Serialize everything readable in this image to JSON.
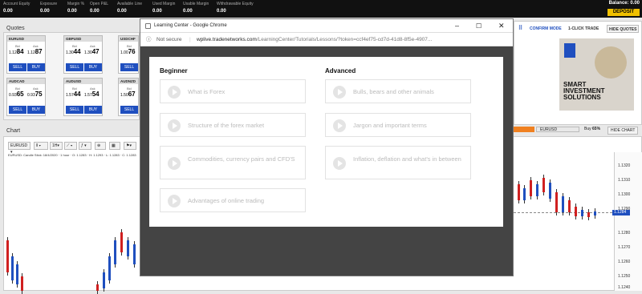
{
  "topbar": {
    "metrics": [
      {
        "label": "Account Equity",
        "value": "0.00"
      },
      {
        "label": "Exposure",
        "value": "0.00"
      },
      {
        "label": "Margin %",
        "value": "0.00"
      },
      {
        "label": "Open P&L",
        "value": "0.00"
      },
      {
        "label": "Available Line",
        "value": "0.00"
      },
      {
        "label": "Used Margin",
        "value": "0.00"
      },
      {
        "label": "Usable Margin",
        "value": "0.00"
      },
      {
        "label": "Withdrawable Equity",
        "value": "0.00"
      }
    ],
    "balance_label": "Balance:",
    "balance_value": "0.00",
    "deposit_label": "DEPOSIT"
  },
  "quotes": {
    "title": "Quotes",
    "cards": [
      {
        "pair": "EURUSD",
        "bid_label": "Bid",
        "ask_label": "Ask",
        "bid_small": "1.12",
        "bid_big": "84",
        "ask_small": "1.12",
        "ask_big": "87",
        "sell": "SELL",
        "buy": "BUY"
      },
      {
        "pair": "GBPUSD",
        "bid_label": "Bid",
        "ask_label": "Ask",
        "bid_small": "1.30",
        "bid_big": "44",
        "ask_small": "1.30",
        "ask_big": "47",
        "sell": "SELL",
        "buy": "BUY"
      },
      {
        "pair": "USDCHF",
        "bid_label": "Bid",
        "ask_label": "",
        "bid_small": "1.00",
        "bid_big": "76",
        "ask_small": "",
        "ask_big": "",
        "sell": "SELL",
        "buy": ""
      },
      {
        "pair": "AUDCAD",
        "bid_label": "Bid",
        "ask_label": "Ask",
        "bid_small": "0.93",
        "bid_big": "65",
        "ask_small": "0.93",
        "ask_big": "75",
        "sell": "SELL",
        "buy": "BUY"
      },
      {
        "pair": "AUDUSD",
        "bid_label": "Bid",
        "ask_label": "Ask",
        "bid_small": "1.57",
        "bid_big": "44",
        "ask_small": "1.57",
        "ask_big": "54",
        "sell": "SELL",
        "buy": "BUY"
      },
      {
        "pair": "AUDNZD",
        "bid_label": "Bid",
        "ask_label": "",
        "bid_small": "1.50",
        "bid_big": "67",
        "ask_small": "",
        "ask_big": "",
        "sell": "SELL",
        "buy": ""
      }
    ]
  },
  "right_buttons": {
    "confirm": "CONFIRM MODE",
    "oneclick": "1-CLICK TRADE",
    "hide_quotes": "HIDE QUOTES"
  },
  "ad": {
    "line1": "SMART",
    "line2": "INVESTMENT",
    "line3": "SOLUTIONS"
  },
  "chart": {
    "title": "Chart",
    "symbol": "EURUSD",
    "interval": "1H",
    "info": "EURUSD: Candle Stick: 18/4/2020 · 1 hour · O: 1.1283 · H: 1.1293 · L: 1.1283 · C: 1.1283",
    "right_symbol": "EURUSD",
    "buy_label": "Buy",
    "buy_pct": "65%",
    "hide_chart": "HIDE CHART",
    "y_ticks": [
      "1.1320",
      "1.1310",
      "1.1300",
      "1.1290",
      "1.1280",
      "1.1270",
      "1.1260",
      "1.1250",
      "1.1240"
    ],
    "current_price": "1.1284"
  },
  "browser": {
    "title": "Learning Center - Google Chrome",
    "not_secure": "Not secure",
    "url_host": "wplive.tradenetworks.com",
    "url_path": "/LearningCenter/Tutorials/Lessons/?token=ccf4ef75-cd7d-41d8-8f5e-4907...",
    "beginner_title": "Beginner",
    "advanced_title": "Advanced",
    "beginner": [
      "What is Forex",
      "Structure of the forex market",
      "Commodities, currency pairs and CFD'S",
      "Advantages of online trading"
    ],
    "advanced": [
      "Bulls, bears and other animals",
      "Jargon and important terms",
      "Inflation, deflation and what's in between"
    ]
  }
}
